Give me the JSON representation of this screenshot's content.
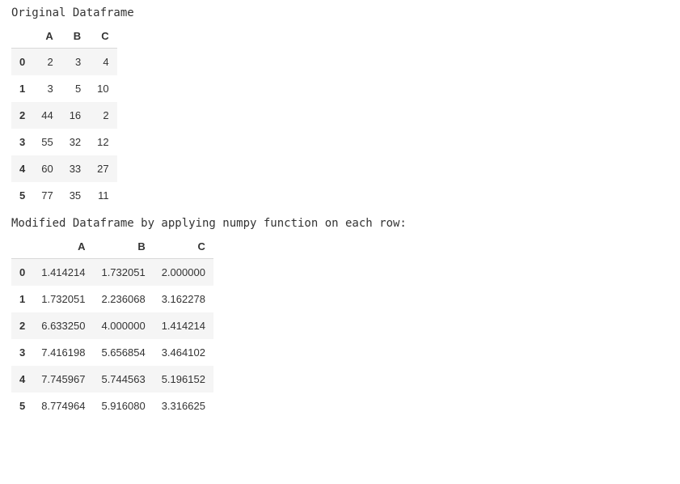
{
  "caption_original": "Original Dataframe",
  "caption_modified": "Modified Dataframe by applying numpy function on each row:",
  "table1": {
    "columns": [
      "A",
      "B",
      "C"
    ],
    "index": [
      "0",
      "1",
      "2",
      "3",
      "4",
      "5"
    ],
    "rows": [
      [
        "2",
        "3",
        "4"
      ],
      [
        "3",
        "5",
        "10"
      ],
      [
        "44",
        "16",
        "2"
      ],
      [
        "55",
        "32",
        "12"
      ],
      [
        "60",
        "33",
        "27"
      ],
      [
        "77",
        "35",
        "11"
      ]
    ]
  },
  "table2": {
    "columns": [
      "A",
      "B",
      "C"
    ],
    "index": [
      "0",
      "1",
      "2",
      "3",
      "4",
      "5"
    ],
    "rows": [
      [
        "1.414214",
        "1.732051",
        "2.000000"
      ],
      [
        "1.732051",
        "2.236068",
        "3.162278"
      ],
      [
        "6.633250",
        "4.000000",
        "1.414214"
      ],
      [
        "7.416198",
        "5.656854",
        "3.464102"
      ],
      [
        "7.745967",
        "5.744563",
        "5.196152"
      ],
      [
        "8.774964",
        "5.916080",
        "3.316625"
      ]
    ]
  },
  "chart_data": [
    {
      "type": "table",
      "title": "Original Dataframe",
      "columns": [
        "A",
        "B",
        "C"
      ],
      "index": [
        0,
        1,
        2,
        3,
        4,
        5
      ],
      "data": [
        [
          2,
          3,
          4
        ],
        [
          3,
          5,
          10
        ],
        [
          44,
          16,
          2
        ],
        [
          55,
          32,
          12
        ],
        [
          60,
          33,
          27
        ],
        [
          77,
          35,
          11
        ]
      ]
    },
    {
      "type": "table",
      "title": "Modified Dataframe by applying numpy function on each row:",
      "columns": [
        "A",
        "B",
        "C"
      ],
      "index": [
        0,
        1,
        2,
        3,
        4,
        5
      ],
      "data": [
        [
          1.414214,
          1.732051,
          2.0
        ],
        [
          1.732051,
          2.236068,
          3.162278
        ],
        [
          6.63325,
          4.0,
          1.414214
        ],
        [
          7.416198,
          5.656854,
          3.464102
        ],
        [
          7.745967,
          5.744563,
          5.196152
        ],
        [
          8.774964,
          5.91608,
          3.316625
        ]
      ]
    }
  ]
}
